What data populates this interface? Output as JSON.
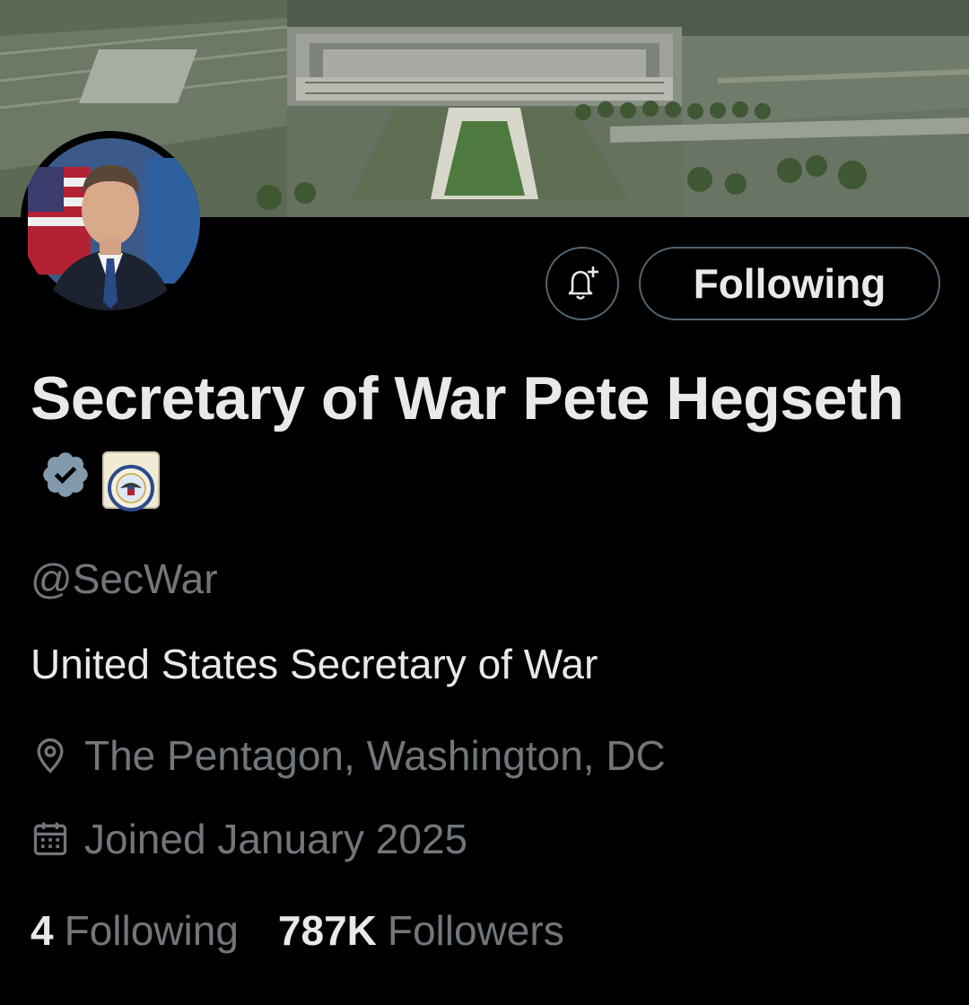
{
  "profile": {
    "display_name": "Secretary of War Pete Hegseth",
    "handle": "@SecWar",
    "bio": "United States Secretary of War",
    "location": "The Pentagon, Washington, DC",
    "joined": "Joined January 2025",
    "following_count": "4",
    "following_label": "Following",
    "followers_count": "787K",
    "followers_label": "Followers"
  },
  "actions": {
    "follow_button_label": "Following"
  },
  "icons": {
    "notify": "bell-plus-icon",
    "verified": "verified-badge-icon",
    "affiliate": "department-seal-icon",
    "location": "location-pin-icon",
    "joined": "calendar-icon"
  },
  "colors": {
    "background": "#000000",
    "primary_text": "#e7e9ea",
    "secondary_text": "#71767b",
    "button_border": "#536471",
    "verified_badge": "#829aab"
  }
}
